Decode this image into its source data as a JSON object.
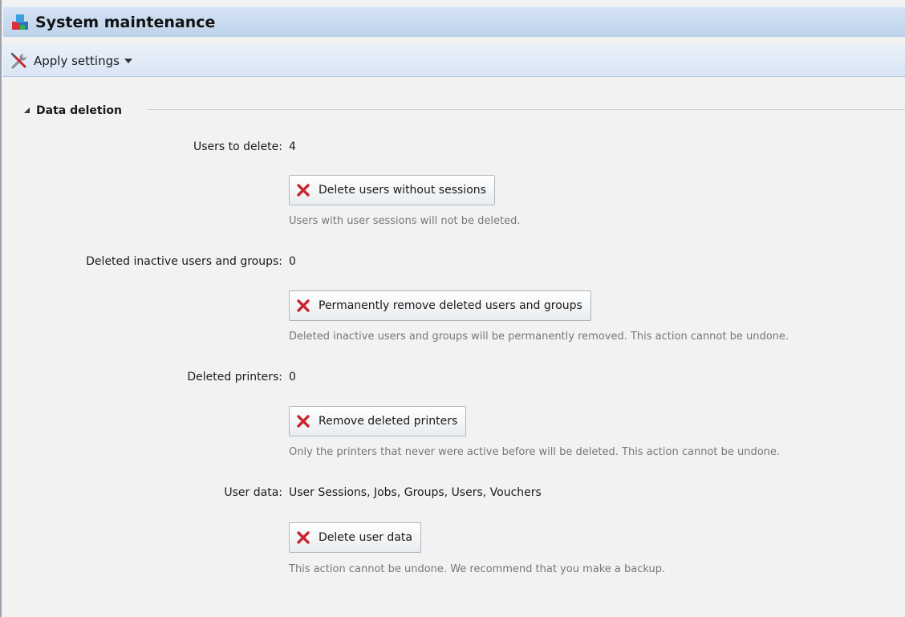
{
  "window": {
    "title": "System maintenance",
    "icon": "blocks-icon"
  },
  "toolbar": {
    "apply_label": "Apply settings",
    "apply_icon": "wrench-screwdriver-icon"
  },
  "section": {
    "title": "Data deletion",
    "rows": [
      {
        "label": "Users to delete:",
        "value": "4",
        "button": "Delete users without sessions",
        "hint": "Users with user sessions will not be deleted."
      },
      {
        "label": "Deleted inactive users and groups:",
        "value": "0",
        "button": "Permanently remove deleted users and groups",
        "hint": "Deleted inactive users and groups will be permanently removed. This action cannot be undone."
      },
      {
        "label": "Deleted printers:",
        "value": "0",
        "button": "Remove deleted printers",
        "hint": "Only the printers that never were active before will be deleted. This action cannot be undone."
      },
      {
        "label": "User data:",
        "value": "User Sessions, Jobs, Groups, Users, Vouchers",
        "button": "Delete user data",
        "hint": "This action cannot be undone. We recommend that you make a backup."
      }
    ]
  },
  "colors": {
    "delete_icon": "#c8262c",
    "titlebar_top": "#d6e4f5",
    "titlebar_bottom": "#bdd2ea"
  }
}
